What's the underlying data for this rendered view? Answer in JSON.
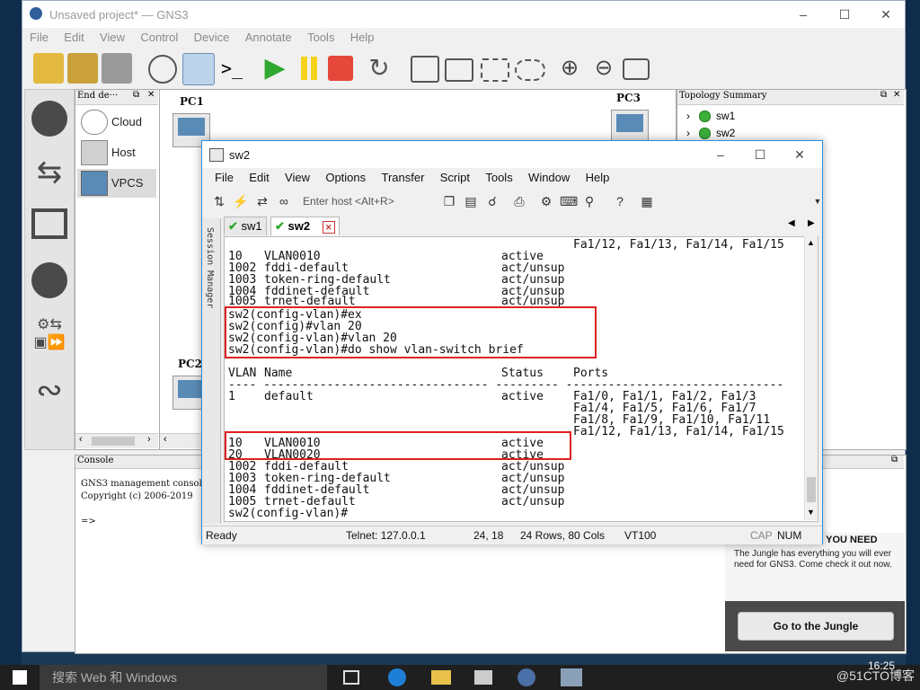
{
  "gns3": {
    "title": "Unsaved project* — GNS3",
    "menu": [
      "File",
      "Edit",
      "View",
      "Control",
      "Device",
      "Annotate",
      "Tools",
      "Help"
    ],
    "end_devices_title": "End de···",
    "devices": [
      "Cloud",
      "Host",
      "VPCS"
    ],
    "canvas_labels": [
      "PC1",
      "PC3",
      "PC2"
    ],
    "topology_title": "Topology Summary",
    "topology_nodes": [
      "sw1",
      "sw2"
    ],
    "console_title": "Console",
    "console_lines": [
      "GNS3 management console",
      "Copyright (c) 2006-2019",
      "=>"
    ],
    "ad_heading": "CE YOU NEED",
    "ad_text": "The Jungle has everything you will ever need for GNS3. Come check it out now.",
    "ad_button": "Go to the Jungle"
  },
  "crt": {
    "title": "sw2",
    "menu": [
      "File",
      "Edit",
      "View",
      "Options",
      "Transfer",
      "Script",
      "Tools",
      "Window",
      "Help"
    ],
    "host_placeholder": "Enter host <Alt+R>",
    "tabs": [
      "sw1",
      "sw2"
    ],
    "session_manager": "Session Manager",
    "top_ports": "Fa1/12, Fa1/13, Fa1/14, Fa1/15",
    "upper_vlans": [
      {
        "id": "10",
        "name": "VLAN0010",
        "status": "active"
      },
      {
        "id": "1002",
        "name": "fddi-default",
        "status": "act/unsup"
      },
      {
        "id": "1003",
        "name": "token-ring-default",
        "status": "act/unsup"
      },
      {
        "id": "1004",
        "name": "fddinet-default",
        "status": "act/unsup"
      },
      {
        "id": "1005",
        "name": "trnet-default",
        "status": "act/unsup"
      }
    ],
    "commands": [
      "sw2(config-vlan)#ex",
      "sw2(config)#vlan 20",
      "sw2(config-vlan)#vlan 20",
      "sw2(config-vlan)#do show vlan-switch brief"
    ],
    "header": {
      "vlan": "VLAN",
      "name": "Name",
      "status": "Status",
      "ports": "Ports"
    },
    "header_rule": "---- -------------------------------- --------- -------------------------------",
    "default_vlan": {
      "id": "1",
      "name": "default",
      "status": "active",
      "ports": [
        "Fa1/0, Fa1/1, Fa1/2, Fa1/3",
        "Fa1/4, Fa1/5, Fa1/6, Fa1/7",
        "Fa1/8, Fa1/9, Fa1/10, Fa1/11",
        "Fa1/12, Fa1/13, Fa1/14, Fa1/15"
      ]
    },
    "lower_vlans": [
      {
        "id": "10",
        "name": "VLAN0010",
        "status": "active"
      },
      {
        "id": "20",
        "name": "VLAN0020",
        "status": "active"
      },
      {
        "id": "1002",
        "name": "fddi-default",
        "status": "act/unsup"
      },
      {
        "id": "1003",
        "name": "token-ring-default",
        "status": "act/unsup"
      },
      {
        "id": "1004",
        "name": "fddinet-default",
        "status": "act/unsup"
      },
      {
        "id": "1005",
        "name": "trnet-default",
        "status": "act/unsup"
      }
    ],
    "prompt": "sw2(config-vlan)#",
    "status": {
      "ready": "Ready",
      "telnet": "Telnet: 127.0.0.1",
      "cursor": "24,  18",
      "size": "24 Rows, 80 Cols",
      "term": "VT100",
      "cap": "CAP",
      "num": "NUM"
    }
  },
  "taskbar": {
    "search": "搜索 Web 和 Windows",
    "time": "16:25",
    "watermark": "@51CTO博客"
  },
  "colors": {
    "highlight": "#e02020",
    "accent": "#2b8fe0",
    "ok_green": "#3bb03b"
  }
}
